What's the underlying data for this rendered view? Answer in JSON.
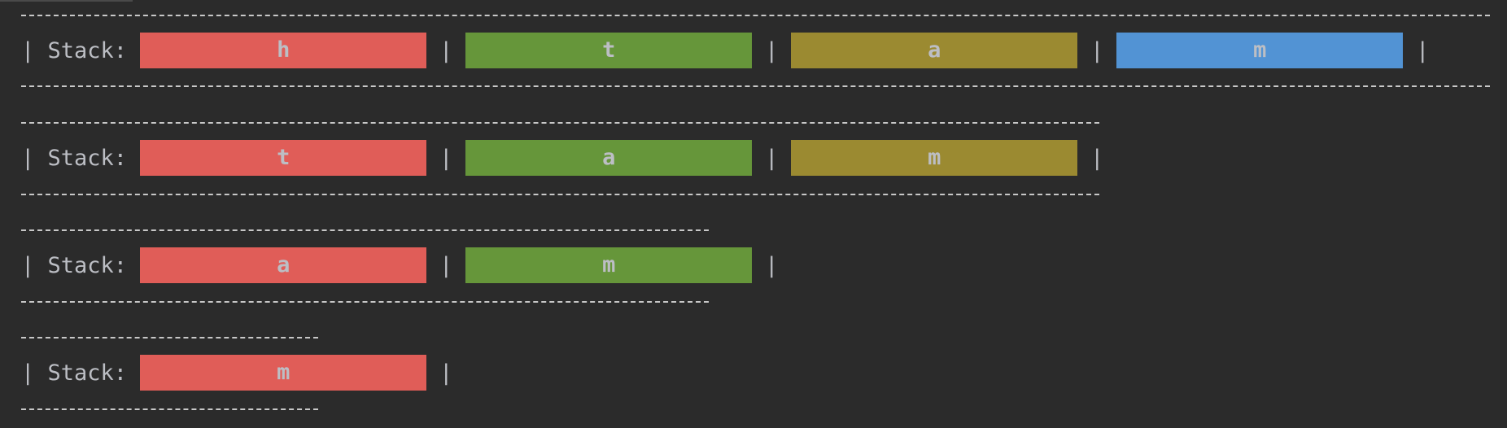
{
  "stacks": [
    {
      "label": "| Stack: ",
      "items": [
        "h",
        "t",
        "a",
        "m"
      ]
    },
    {
      "label": "| Stack: ",
      "items": [
        "t",
        "a",
        "m"
      ]
    },
    {
      "label": "| Stack: ",
      "items": [
        "a",
        "m"
      ]
    },
    {
      "label": "| Stack: ",
      "items": [
        "m"
      ]
    }
  ],
  "separator": "|",
  "colors": {
    "background": "#2b2b2b",
    "c1": "#e05d58",
    "c2": "#66963a",
    "c3": "#9b8a31",
    "c4": "#5293d4"
  }
}
